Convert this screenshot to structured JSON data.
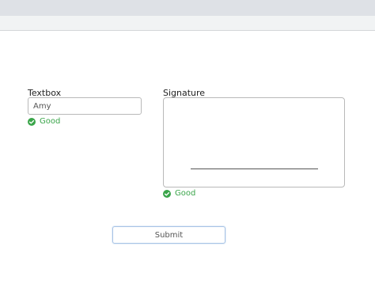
{
  "form": {
    "textbox": {
      "label": "Textbox",
      "value": "Amy",
      "status": "Good"
    },
    "signature": {
      "label": "Signature",
      "status": "Good"
    },
    "submit_label": "Submit"
  },
  "colors": {
    "valid_green": "#3aa54a",
    "submit_border": "#a9c4e6"
  },
  "icons": {
    "valid": "check-circle-icon"
  }
}
